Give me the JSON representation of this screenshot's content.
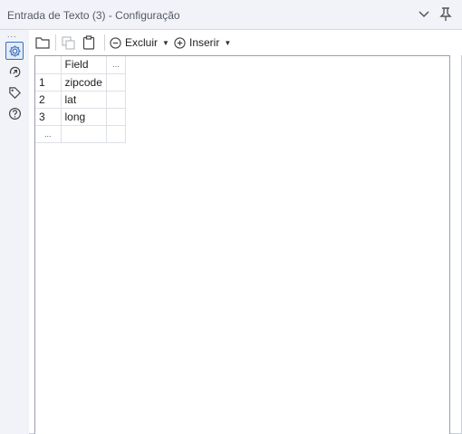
{
  "window": {
    "title": "Entrada de Texto (3) - Configuração"
  },
  "leftbar": {
    "overflow": "...",
    "items": [
      {
        "icon": "gear-icon",
        "active": true
      },
      {
        "icon": "connection-icon",
        "active": false
      },
      {
        "icon": "tag-icon",
        "active": false
      },
      {
        "icon": "help-icon",
        "active": false
      }
    ]
  },
  "toolbar": {
    "delete_label": "Excluir",
    "insert_label": "Inserir"
  },
  "grid": {
    "header": "Field",
    "more": "...",
    "rows": [
      {
        "n": "1",
        "value": "zipcode"
      },
      {
        "n": "2",
        "value": "lat"
      },
      {
        "n": "3",
        "value": "long"
      }
    ],
    "new_row": "..."
  },
  "colors": {
    "accent": "#3a6fbf",
    "panel_bg": "#f2f3f8"
  }
}
